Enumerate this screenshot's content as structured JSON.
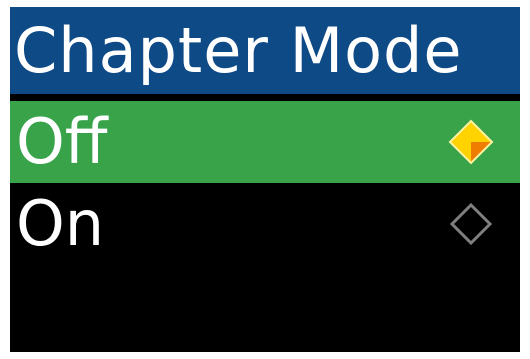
{
  "screen": {
    "title": "Chapter Mode",
    "colors": {
      "title_bg": "#0d4a86",
      "selected_bg": "#39a349",
      "background": "#000000",
      "text": "#ffffff",
      "radio_selected": "#ffd300",
      "radio_selected_shade": "#f07c00",
      "radio_unselected": "#7f7f7f"
    }
  },
  "menu": {
    "items": [
      {
        "label": "Off",
        "selected": true,
        "indicator": "filled-diamond-icon"
      },
      {
        "label": "On",
        "selected": false,
        "indicator": "hollow-diamond-icon"
      }
    ]
  }
}
